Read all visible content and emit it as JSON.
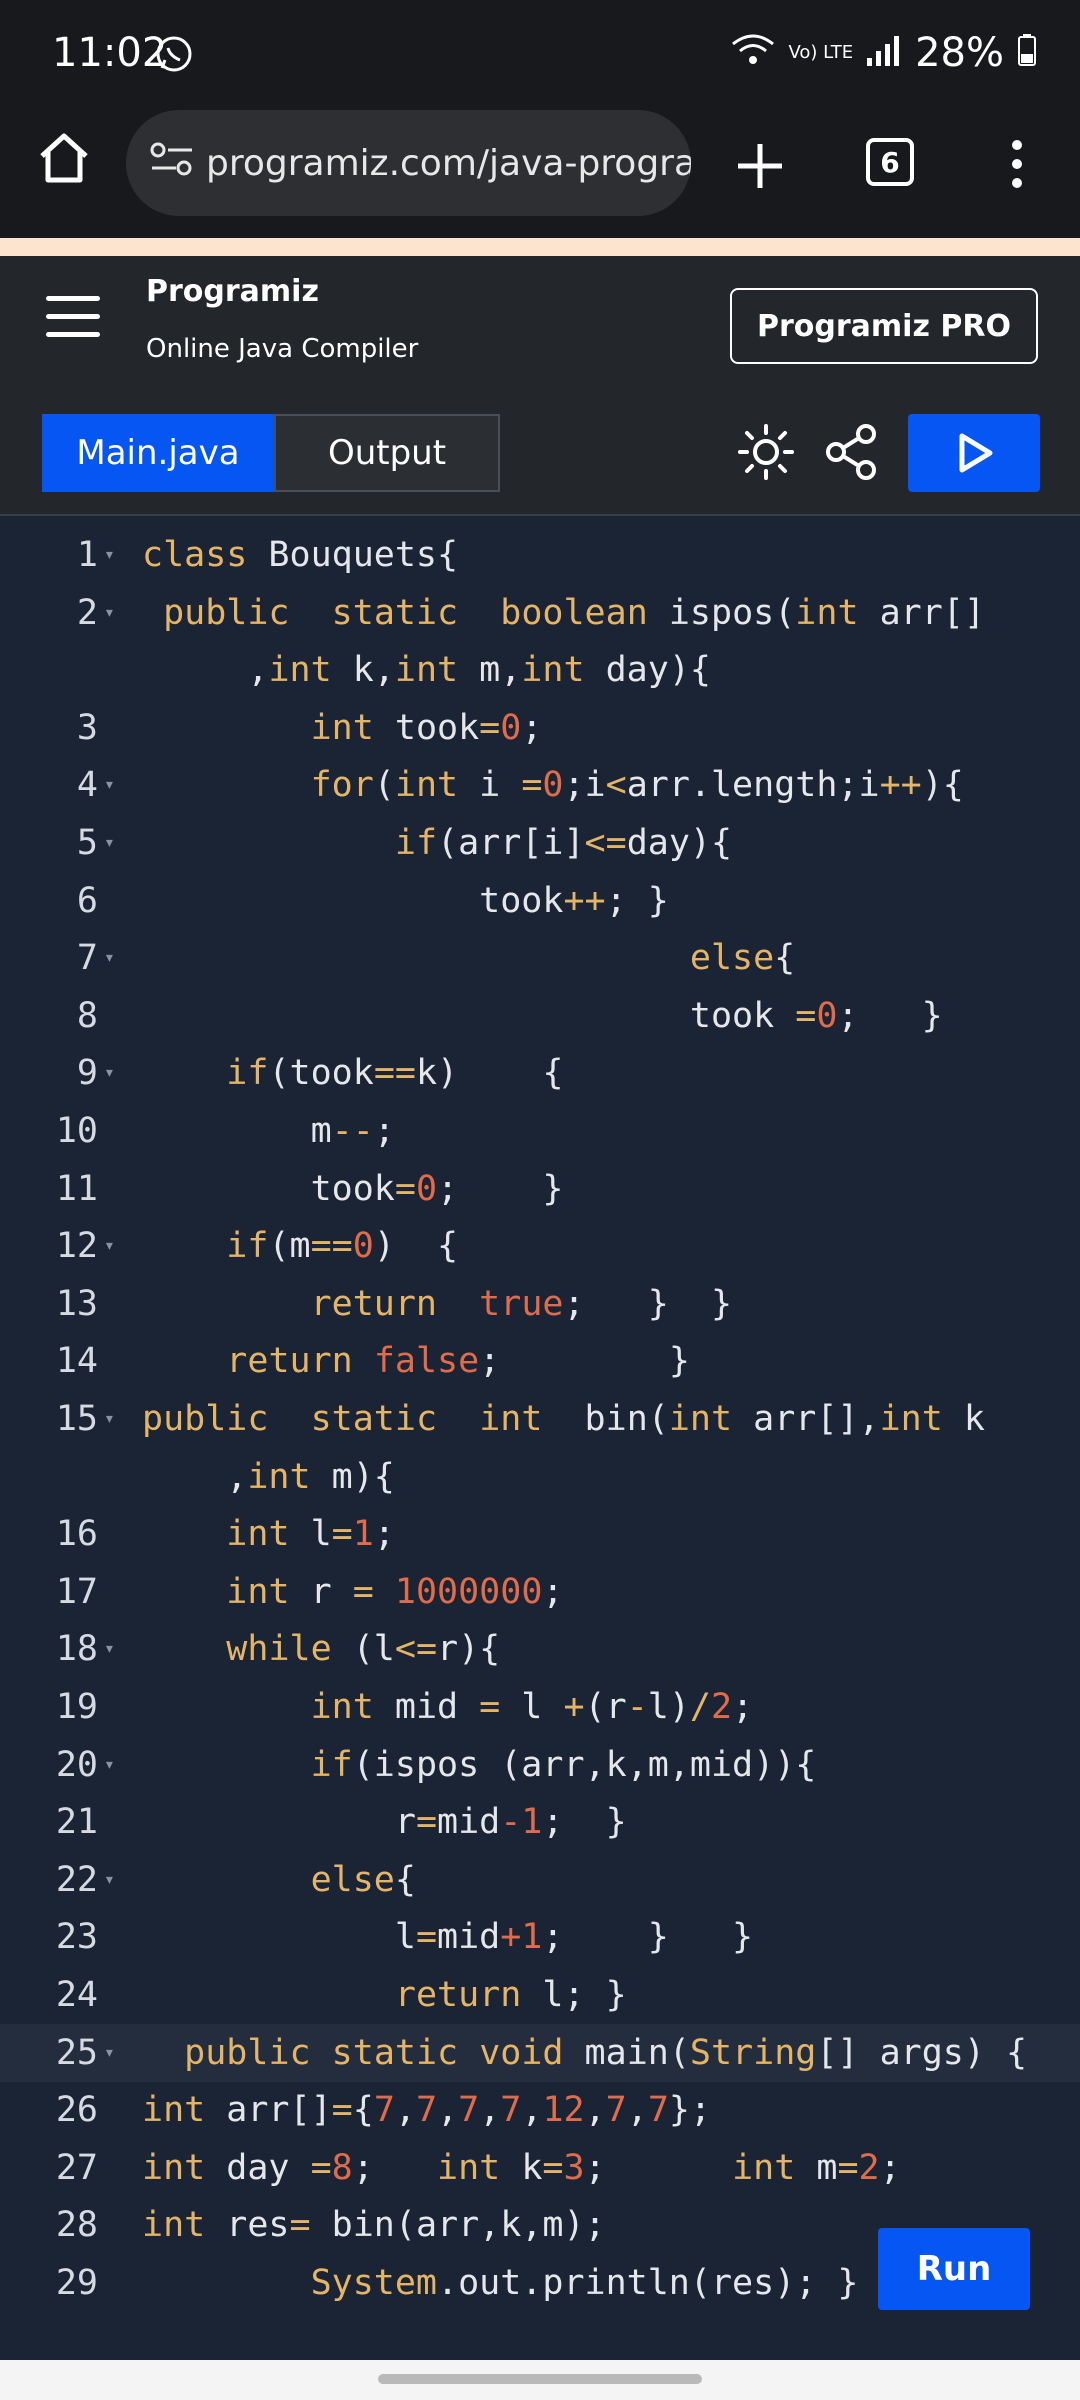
{
  "status": {
    "time": "11:02",
    "network": "Vo) LTE",
    "battery": "28%"
  },
  "browser": {
    "url": "programiz.com/java-programi",
    "tab_count": "6"
  },
  "header": {
    "logo_text": "Programiz",
    "subtitle": "Online Java Compiler",
    "pro_button": "Programiz PRO"
  },
  "tabs": {
    "main": "Main.java",
    "output": "Output"
  },
  "run_label": "Run",
  "colors": {
    "keyword": "#e5b567",
    "number": "#e06c4b",
    "text": "#e5e7eb",
    "accent": "#0556f3"
  },
  "code_lines": [
    {
      "n": "1",
      "fold": true,
      "tokens": [
        [
          "class",
          "kw"
        ],
        [
          " Bouquets{",
          "tx"
        ]
      ]
    },
    {
      "n": "2",
      "fold": true,
      "tokens": [
        [
          " public",
          "kw"
        ],
        [
          "  ",
          "tx"
        ],
        [
          "static",
          "kw"
        ],
        [
          "  ",
          "tx"
        ],
        [
          "boolean",
          "kw"
        ],
        [
          " ispos(",
          "tx"
        ],
        [
          "int",
          "kw"
        ],
        [
          " arr[]",
          "tx"
        ]
      ]
    },
    {
      "n": "",
      "fold": false,
      "tokens": [
        [
          "     ,",
          "tx"
        ],
        [
          "int",
          "kw"
        ],
        [
          " k,",
          "tx"
        ],
        [
          "int",
          "kw"
        ],
        [
          " m,",
          "tx"
        ],
        [
          "int",
          "kw"
        ],
        [
          " day){",
          "tx"
        ]
      ]
    },
    {
      "n": "3",
      "fold": false,
      "tokens": [
        [
          "        ",
          "tx"
        ],
        [
          "int",
          "kw"
        ],
        [
          " took",
          "tx"
        ],
        [
          "=",
          "kw"
        ],
        [
          "0",
          "nm"
        ],
        [
          ";",
          "tx"
        ]
      ]
    },
    {
      "n": "4",
      "fold": true,
      "tokens": [
        [
          "        ",
          "tx"
        ],
        [
          "for",
          "kw"
        ],
        [
          "(",
          "tx"
        ],
        [
          "int",
          "kw"
        ],
        [
          " i ",
          "tx"
        ],
        [
          "=",
          "kw"
        ],
        [
          "0",
          "nm"
        ],
        [
          ";i",
          "tx"
        ],
        [
          "<",
          "kw"
        ],
        [
          "arr.length;i",
          "tx"
        ],
        [
          "++",
          "kw"
        ],
        [
          "){",
          "tx"
        ]
      ]
    },
    {
      "n": "5",
      "fold": true,
      "tokens": [
        [
          "            ",
          "tx"
        ],
        [
          "if",
          "kw"
        ],
        [
          "(arr[i]",
          "tx"
        ],
        [
          "<=",
          "kw"
        ],
        [
          "day){",
          "tx"
        ]
      ]
    },
    {
      "n": "6",
      "fold": false,
      "tokens": [
        [
          "                took",
          "tx"
        ],
        [
          "++",
          "kw"
        ],
        [
          "; }",
          "tx"
        ]
      ]
    },
    {
      "n": "7",
      "fold": true,
      "tokens": [
        [
          "                          ",
          "tx"
        ],
        [
          "else",
          "kw"
        ],
        [
          "{",
          "tx"
        ]
      ]
    },
    {
      "n": "8",
      "fold": false,
      "tokens": [
        [
          "                          took ",
          "tx"
        ],
        [
          "=",
          "kw"
        ],
        [
          "0",
          "nm"
        ],
        [
          ";   }",
          "tx"
        ]
      ]
    },
    {
      "n": "9",
      "fold": true,
      "tokens": [
        [
          "    ",
          "tx"
        ],
        [
          "if",
          "kw"
        ],
        [
          "(took",
          "tx"
        ],
        [
          "==",
          "kw"
        ],
        [
          "k)    {",
          "tx"
        ]
      ]
    },
    {
      "n": "10",
      "fold": false,
      "tokens": [
        [
          "        m",
          "tx"
        ],
        [
          "--",
          "kw"
        ],
        [
          ";",
          "tx"
        ]
      ]
    },
    {
      "n": "11",
      "fold": false,
      "tokens": [
        [
          "        took",
          "tx"
        ],
        [
          "=",
          "kw"
        ],
        [
          "0",
          "nm"
        ],
        [
          ";    }",
          "tx"
        ]
      ]
    },
    {
      "n": "12",
      "fold": true,
      "tokens": [
        [
          "    ",
          "tx"
        ],
        [
          "if",
          "kw"
        ],
        [
          "(m",
          "tx"
        ],
        [
          "==",
          "kw"
        ],
        [
          "0",
          "nm"
        ],
        [
          ")  {",
          "tx"
        ]
      ]
    },
    {
      "n": "13",
      "fold": false,
      "tokens": [
        [
          "        ",
          "tx"
        ],
        [
          "return",
          "kw"
        ],
        [
          "  ",
          "tx"
        ],
        [
          "true",
          "nm"
        ],
        [
          ";   }  }",
          "tx"
        ]
      ]
    },
    {
      "n": "14",
      "fold": false,
      "tokens": [
        [
          "    ",
          "tx"
        ],
        [
          "return",
          "kw"
        ],
        [
          " ",
          "tx"
        ],
        [
          "false",
          "nm"
        ],
        [
          ";        }",
          "tx"
        ]
      ]
    },
    {
      "n": "15",
      "fold": true,
      "tokens": [
        [
          "public",
          "kw"
        ],
        [
          "  ",
          "tx"
        ],
        [
          "static",
          "kw"
        ],
        [
          "  ",
          "tx"
        ],
        [
          "int",
          "kw"
        ],
        [
          "  bin(",
          "tx"
        ],
        [
          "int",
          "kw"
        ],
        [
          " arr[],",
          "tx"
        ],
        [
          "int",
          "kw"
        ],
        [
          " k",
          "tx"
        ]
      ]
    },
    {
      "n": "",
      "fold": false,
      "tokens": [
        [
          "    ,",
          "tx"
        ],
        [
          "int",
          "kw"
        ],
        [
          " m){",
          "tx"
        ]
      ]
    },
    {
      "n": "16",
      "fold": false,
      "tokens": [
        [
          "    ",
          "tx"
        ],
        [
          "int",
          "kw"
        ],
        [
          " l",
          "tx"
        ],
        [
          "=",
          "kw"
        ],
        [
          "1",
          "nm"
        ],
        [
          ";",
          "tx"
        ]
      ]
    },
    {
      "n": "17",
      "fold": false,
      "tokens": [
        [
          "    ",
          "tx"
        ],
        [
          "int",
          "kw"
        ],
        [
          " r ",
          "tx"
        ],
        [
          "=",
          "kw"
        ],
        [
          " ",
          "tx"
        ],
        [
          "1000000",
          "nm"
        ],
        [
          ";",
          "tx"
        ]
      ]
    },
    {
      "n": "18",
      "fold": true,
      "tokens": [
        [
          "    ",
          "tx"
        ],
        [
          "while",
          "kw"
        ],
        [
          " (l",
          "tx"
        ],
        [
          "<=",
          "kw"
        ],
        [
          "r){",
          "tx"
        ]
      ]
    },
    {
      "n": "19",
      "fold": false,
      "tokens": [
        [
          "        ",
          "tx"
        ],
        [
          "int",
          "kw"
        ],
        [
          " mid ",
          "tx"
        ],
        [
          "=",
          "kw"
        ],
        [
          " l ",
          "tx"
        ],
        [
          "+",
          "kw"
        ],
        [
          "(r",
          "tx"
        ],
        [
          "-",
          "kw"
        ],
        [
          "l)",
          "tx"
        ],
        [
          "/",
          "kw"
        ],
        [
          "2",
          "nm"
        ],
        [
          ";",
          "tx"
        ]
      ]
    },
    {
      "n": "20",
      "fold": true,
      "tokens": [
        [
          "        ",
          "tx"
        ],
        [
          "if",
          "kw"
        ],
        [
          "(ispos (arr,k,m,mid)){",
          "tx"
        ]
      ]
    },
    {
      "n": "21",
      "fold": false,
      "tokens": [
        [
          "            r",
          "tx"
        ],
        [
          "=",
          "kw"
        ],
        [
          "mid",
          "tx"
        ],
        [
          "-1",
          "nm"
        ],
        [
          ";  }",
          "tx"
        ]
      ]
    },
    {
      "n": "22",
      "fold": true,
      "tokens": [
        [
          "        ",
          "tx"
        ],
        [
          "else",
          "kw"
        ],
        [
          "{",
          "tx"
        ]
      ]
    },
    {
      "n": "23",
      "fold": false,
      "tokens": [
        [
          "            l",
          "tx"
        ],
        [
          "=",
          "kw"
        ],
        [
          "mid",
          "tx"
        ],
        [
          "+1",
          "nm"
        ],
        [
          ";    }   }",
          "tx"
        ]
      ]
    },
    {
      "n": "24",
      "fold": false,
      "tokens": [
        [
          "            ",
          "tx"
        ],
        [
          "return",
          "kw"
        ],
        [
          " l; }",
          "tx"
        ]
      ]
    },
    {
      "n": "25",
      "fold": true,
      "active": true,
      "tokens": [
        [
          "  ",
          "tx"
        ],
        [
          "public",
          "kw"
        ],
        [
          " ",
          "tx"
        ],
        [
          "static",
          "kw"
        ],
        [
          " ",
          "tx"
        ],
        [
          "void",
          "kw"
        ],
        [
          " main(",
          "tx"
        ],
        [
          "String",
          "kw"
        ],
        [
          "[] args) {",
          "tx"
        ]
      ]
    },
    {
      "n": "26",
      "fold": false,
      "tokens": [
        [
          "int",
          "kw"
        ],
        [
          " arr[]",
          "tx"
        ],
        [
          "=",
          "kw"
        ],
        [
          "{",
          "tx"
        ],
        [
          "7",
          "nm"
        ],
        [
          ",",
          "tx"
        ],
        [
          "7",
          "nm"
        ],
        [
          ",",
          "tx"
        ],
        [
          "7",
          "nm"
        ],
        [
          ",",
          "tx"
        ],
        [
          "7",
          "nm"
        ],
        [
          ",",
          "tx"
        ],
        [
          "12",
          "nm"
        ],
        [
          ",",
          "tx"
        ],
        [
          "7",
          "nm"
        ],
        [
          ",",
          "tx"
        ],
        [
          "7",
          "nm"
        ],
        [
          "};",
          "tx"
        ]
      ]
    },
    {
      "n": "27",
      "fold": false,
      "tokens": [
        [
          "int",
          "kw"
        ],
        [
          " day ",
          "tx"
        ],
        [
          "=",
          "kw"
        ],
        [
          "8",
          "nm"
        ],
        [
          ";   ",
          "tx"
        ],
        [
          "int",
          "kw"
        ],
        [
          " k",
          "tx"
        ],
        [
          "=",
          "kw"
        ],
        [
          "3",
          "nm"
        ],
        [
          ";      ",
          "tx"
        ],
        [
          "int",
          "kw"
        ],
        [
          " m",
          "tx"
        ],
        [
          "=",
          "kw"
        ],
        [
          "2",
          "nm"
        ],
        [
          ";",
          "tx"
        ]
      ]
    },
    {
      "n": "28",
      "fold": false,
      "tokens": [
        [
          "int",
          "kw"
        ],
        [
          " res",
          "tx"
        ],
        [
          "=",
          "kw"
        ],
        [
          " bin(arr,k,m);",
          "tx"
        ]
      ]
    },
    {
      "n": "29",
      "fold": false,
      "tokens": [
        [
          "        ",
          "tx"
        ],
        [
          "System",
          "kw"
        ],
        [
          ".out.println(res); }",
          "tx"
        ]
      ]
    }
  ]
}
